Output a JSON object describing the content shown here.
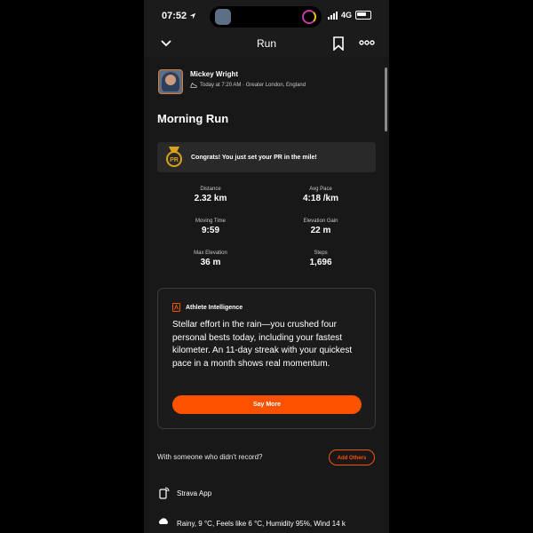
{
  "status_bar": {
    "time": "07:52",
    "network": "4G"
  },
  "navbar": {
    "title": "Run"
  },
  "athlete": {
    "name": "Mickey Wright",
    "meta": "Today at 7:20 AM · Greater London, England"
  },
  "activity": {
    "title": "Morning Run"
  },
  "pr_banner": {
    "badge": "PR",
    "message": "Congrats! You just set your PR in the mile!"
  },
  "stats": [
    {
      "label": "Distance",
      "value": "2.32 km"
    },
    {
      "label": "Avg Pace",
      "value": "4:18 /km"
    },
    {
      "label": "Moving Time",
      "value": "9:59"
    },
    {
      "label": "Elevation Gain",
      "value": "22 m"
    },
    {
      "label": "Max Elevation",
      "value": "36 m"
    },
    {
      "label": "Steps",
      "value": "1,696"
    }
  ],
  "athlete_intelligence": {
    "title": "Athlete Intelligence",
    "text": "Stellar effort in the rain—you crushed four personal bests today, including your fastest kilometer. An 11-day streak with your quickest pace in a month shows real momentum.",
    "button": "Say More"
  },
  "record_prompt": {
    "text": "With someone who didn't record?",
    "button": "Add Others"
  },
  "device": {
    "name": "Strava App"
  },
  "weather": {
    "text": "Rainy, 9 °C, Feels like 6 °C, Humidity 95%, Wind 14 k"
  },
  "colors": {
    "accent": "#fc5200",
    "background": "#181818",
    "card": "#2a292a"
  }
}
